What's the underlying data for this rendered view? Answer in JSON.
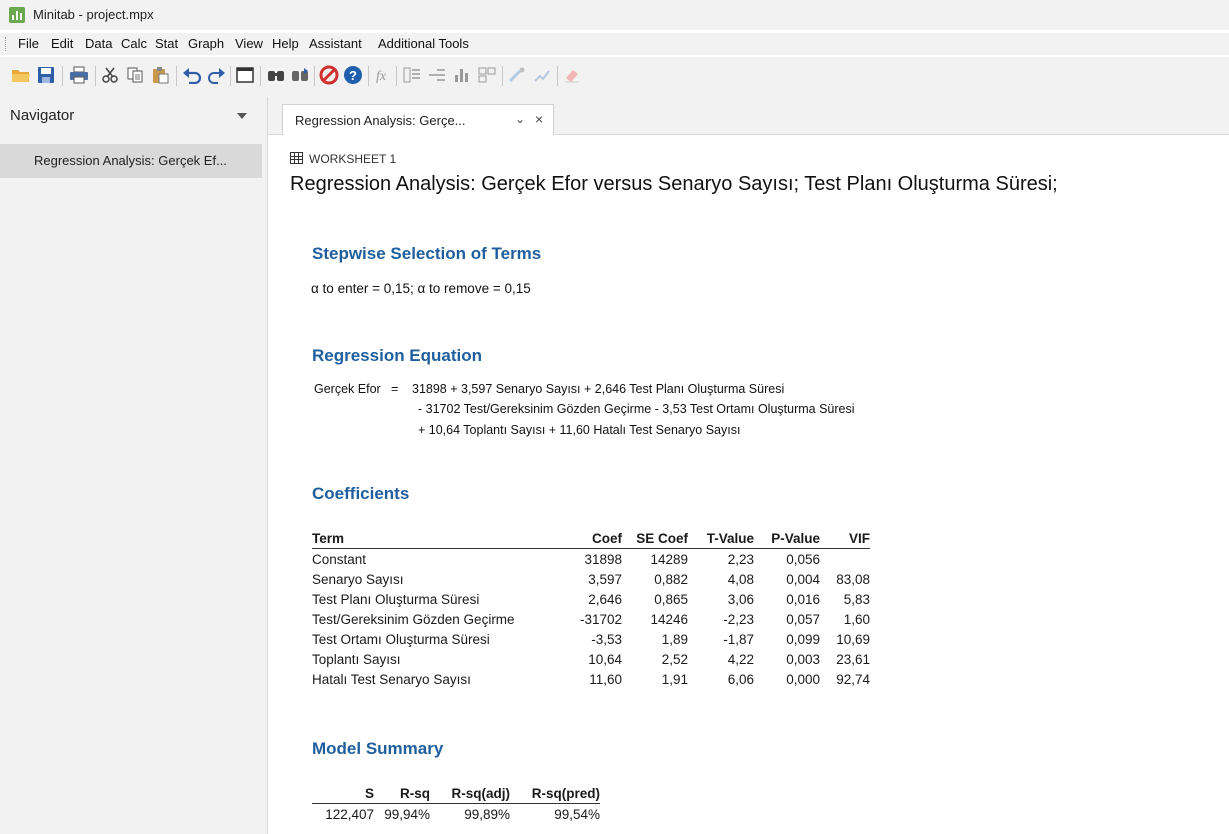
{
  "window": {
    "title": "Minitab - project.mpx"
  },
  "menu": [
    "File",
    "Edit",
    "Data",
    "Calc",
    "Stat",
    "Graph",
    "View",
    "Help",
    "Assistant",
    "Additional Tools"
  ],
  "toolbar_icons": [
    "open-icon",
    "save-icon",
    "print-icon",
    "cut-icon",
    "copy-icon",
    "paste-icon",
    "undo-icon",
    "redo-icon",
    "window-icon",
    "find-icon",
    "find-next-icon",
    "cancel-icon",
    "help-icon",
    "fx-icon",
    "stack-icon",
    "align-icon",
    "bar-icon",
    "layout-icon",
    "brush-icon",
    "graph-edit-icon",
    "eraser-icon"
  ],
  "navigator": {
    "header": "Navigator",
    "items": [
      {
        "label": "Regression Analysis: Gerçek Ef..."
      }
    ]
  },
  "tab": {
    "label": "Regression Analysis: Gerçe...",
    "chevron": "⌄",
    "close": "×"
  },
  "output": {
    "worksheet": "WORKSHEET 1",
    "title": "Regression Analysis: Gerçek Efor versus Senaryo Sayısı; Test Planı Oluşturma Süresi;",
    "stepwise": {
      "heading": "Stepwise Selection of Terms",
      "text": "α to enter = 0,15; α to remove = 0,15"
    },
    "equation": {
      "heading": "Regression Equation",
      "response": "Gerçek Efor",
      "equals": "=",
      "line1": "31898 + 3,597 Senaryo Sayısı + 2,646 Test Planı Oluşturma Süresi",
      "line2": "- 31702 Test/Gereksinim Gözden Geçirme - 3,53 Test Ortamı Oluşturma Süresi",
      "line3": "+ 10,64 Toplantı Sayısı + 11,60 Hatalı Test Senaryo Sayısı"
    },
    "coefficients": {
      "heading": "Coefficients",
      "columns": [
        "Term",
        "Coef",
        "SE Coef",
        "T-Value",
        "P-Value",
        "VIF"
      ],
      "rows": [
        [
          "Constant",
          "31898",
          "14289",
          "2,23",
          "0,056",
          ""
        ],
        [
          "Senaryo Sayısı",
          "3,597",
          "0,882",
          "4,08",
          "0,004",
          "83,08"
        ],
        [
          "Test Planı Oluşturma Süresi",
          "2,646",
          "0,865",
          "3,06",
          "0,016",
          "5,83"
        ],
        [
          "Test/Gereksinim Gözden Geçirme",
          "-31702",
          "14246",
          "-2,23",
          "0,057",
          "1,60"
        ],
        [
          "Test Ortamı Oluşturma Süresi",
          "-3,53",
          "1,89",
          "-1,87",
          "0,099",
          "10,69"
        ],
        [
          "Toplantı Sayısı",
          "10,64",
          "2,52",
          "4,22",
          "0,003",
          "23,61"
        ],
        [
          "Hatalı Test Senaryo Sayısı",
          "11,60",
          "1,91",
          "6,06",
          "0,000",
          "92,74"
        ]
      ]
    },
    "model_summary": {
      "heading": "Model Summary",
      "columns": [
        "S",
        "R-sq",
        "R-sq(adj)",
        "R-sq(pred)"
      ],
      "rows": [
        [
          "122,407",
          "99,94%",
          "99,89%",
          "99,54%"
        ]
      ]
    }
  },
  "colors": {
    "heading": "#1f5f9e",
    "chrome": "#f2f2f2",
    "selected": "#d9d9d9"
  }
}
